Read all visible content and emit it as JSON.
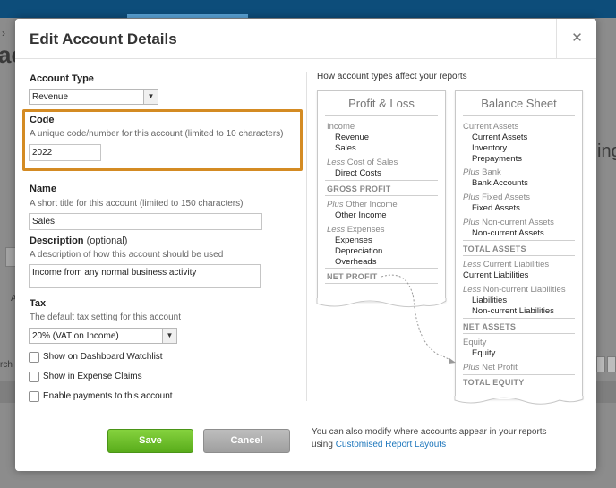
{
  "background": {
    "fragment_breadcrumb": "›",
    "fragment_left_big": "ac",
    "fragment_right_big": "ing",
    "fragment_left_small_a": "A",
    "fragment_left_small_rch": "rch"
  },
  "dialog": {
    "title": "Edit Account Details",
    "close_glyph": "✕"
  },
  "form": {
    "account_type": {
      "label": "Account Type",
      "value": "Revenue"
    },
    "code": {
      "label": "Code",
      "hint": "A unique code/number for this account (limited to 10 characters)",
      "value": "2022"
    },
    "name": {
      "label": "Name",
      "hint": "A short title for this account (limited to 150 characters)",
      "value": "Sales"
    },
    "description": {
      "label": "Description",
      "optional": "(optional)",
      "hint": "A description of how this account should be used",
      "value": "Income from any normal business activity"
    },
    "tax": {
      "label": "Tax",
      "hint": "The default tax setting for this account",
      "value": "20% (VAT on Income)"
    },
    "checkboxes": [
      {
        "label": "Show on Dashboard Watchlist",
        "checked": false
      },
      {
        "label": "Show in Expense Claims",
        "checked": false
      },
      {
        "label": "Enable payments to this account",
        "checked": false
      }
    ]
  },
  "reports_panel": {
    "heading": "How account types affect your reports",
    "profit_loss": {
      "title": "Profit & Loss",
      "income": "Income",
      "revenue": "Revenue",
      "sales": "Sales",
      "less_word": "Less",
      "cost_of_sales": "Cost of Sales",
      "direct_costs": "Direct Costs",
      "gross_profit": "GROSS PROFIT",
      "plus_word": "Plus",
      "other_income_group": "Other Income",
      "other_income": "Other Income",
      "expenses_group": "Expenses",
      "expenses": "Expenses",
      "depreciation": "Depreciation",
      "overheads": "Overheads",
      "net_profit": "NET PROFIT"
    },
    "balance_sheet": {
      "title": "Balance Sheet",
      "current_assets_group": "Current Assets",
      "current_assets": "Current Assets",
      "inventory": "Inventory",
      "prepayments": "Prepayments",
      "plus_word": "Plus",
      "bank_group": "Bank",
      "bank_accounts": "Bank Accounts",
      "fixed_assets_group": "Fixed Assets",
      "fixed_assets": "Fixed Assets",
      "noncurrent_assets_group": "Non-current Assets",
      "noncurrent_assets": "Non-current Assets",
      "total_assets": "TOTAL ASSETS",
      "less_word": "Less",
      "current_liabilities_group": "Current Liabilities",
      "current_liabilities": "Current Liabilities",
      "noncurrent_liabilities_group": "Non-current Liabilities",
      "liabilities": "Liabilities",
      "noncurrent_liabilities": "Non-current Liabilities",
      "net_assets": "NET ASSETS",
      "equity_group": "Equity",
      "equity": "Equity",
      "net_profit": "Net Profit",
      "total_equity": "TOTAL EQUITY"
    }
  },
  "footer": {
    "save_label": "Save",
    "cancel_label": "Cancel",
    "note_text": "You can also modify where accounts appear in your reports using",
    "note_link": "Customised Report Layouts"
  },
  "colors": {
    "highlight": "#d48b23",
    "save_button": "#6cbf2a",
    "link": "#1b75bb"
  }
}
